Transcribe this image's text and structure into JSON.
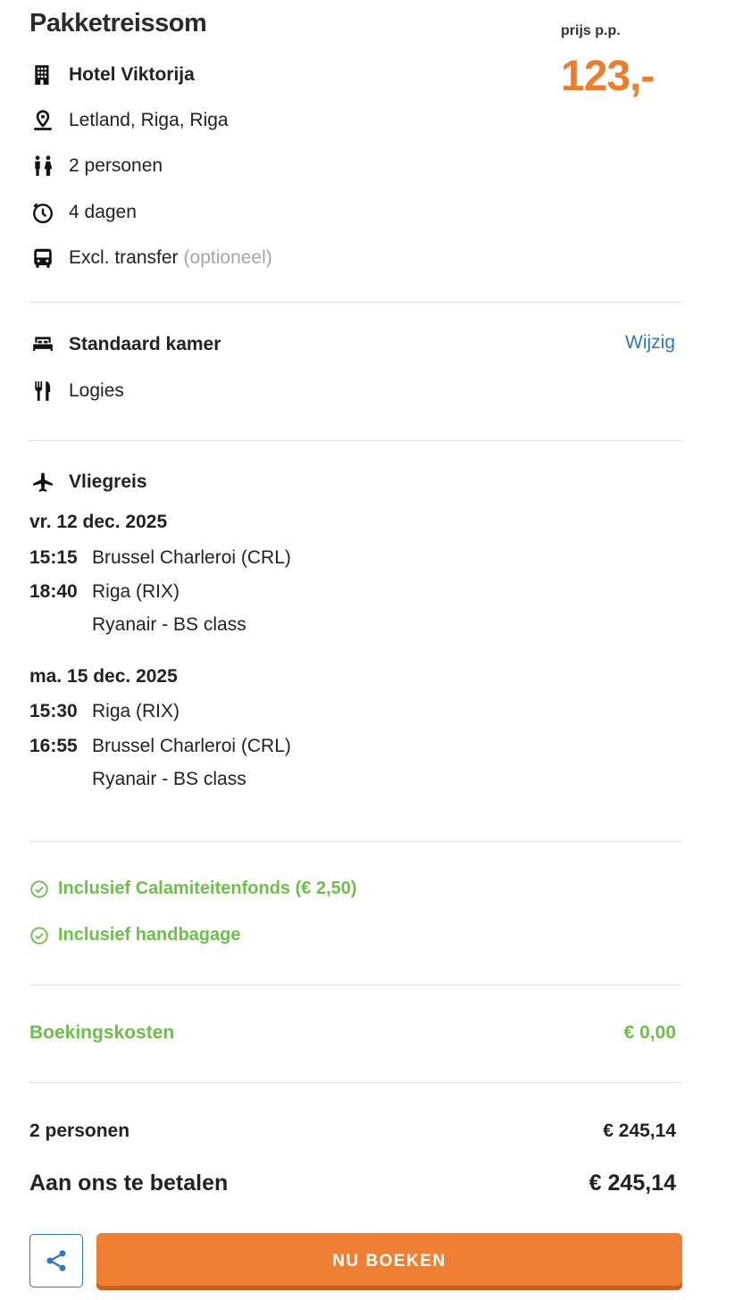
{
  "header": {
    "title": "Pakketreissom",
    "price_label": "prijs p.p.",
    "price": "123,-"
  },
  "trip": {
    "hotel": "Hotel Viktorija",
    "location": "Letland, Riga, Riga",
    "persons": "2 personen",
    "duration": "4 dagen",
    "transfer": "Excl. transfer",
    "transfer_note": "(optioneel)"
  },
  "room": {
    "type": "Standaard kamer",
    "change_link": "Wijzig",
    "board": "Logies"
  },
  "flight": {
    "title": "Vliegreis",
    "outbound": {
      "date": "vr. 12 dec. 2025",
      "dep_time": "15:15",
      "dep_place": "Brussel Charleroi (CRL)",
      "arr_time": "18:40",
      "arr_place": "Riga (RIX)",
      "carrier": "Ryanair - BS class"
    },
    "return": {
      "date": "ma. 15 dec. 2025",
      "dep_time": "15:30",
      "dep_place": "Riga (RIX)",
      "arr_time": "16:55",
      "arr_place": "Brussel Charleroi (CRL)",
      "carrier": "Ryanair - BS class"
    }
  },
  "inclusions": [
    "Inclusief Calamiteitenfonds (€ 2,50)",
    "Inclusief handbagage"
  ],
  "costs": {
    "booking_label": "Boekingskosten",
    "booking_value": "€ 0,00",
    "persons_label": "2 personen",
    "persons_value": "€ 245,14",
    "total_label": "Aan ons te betalen",
    "total_value": "€ 245,14"
  },
  "actions": {
    "book_label": "NU BOEKEN"
  },
  "colors": {
    "accent_orange": "#ee7d2b",
    "link_blue": "#2c78c4",
    "success_green": "#6cc04a"
  },
  "icons": [
    "building-icon",
    "map-pin-icon",
    "persons-icon",
    "clock-icon",
    "bus-icon",
    "bed-icon",
    "cutlery-icon",
    "airplane-icon",
    "check-circle-icon",
    "share-icon"
  ]
}
